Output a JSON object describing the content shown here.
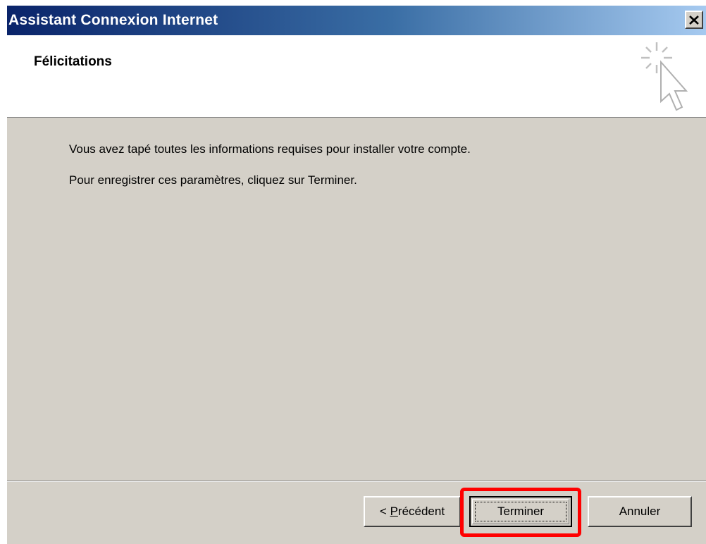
{
  "window": {
    "title": "Assistant Connexion Internet",
    "close_symbol": "✕",
    "close_icon": "close-icon"
  },
  "header": {
    "title": "Félicitations",
    "icon": "wizard-cursor-sparkle-icon"
  },
  "content": {
    "line1": "Vous avez tapé toutes les informations requises pour installer votre compte.",
    "line2": "Pour enregistrer ces paramètres, cliquez sur Terminer."
  },
  "buttons": {
    "prev_prefix": "< ",
    "prev_accel": "P",
    "prev_rest": "récédent",
    "finish": "Terminer",
    "cancel": "Annuler"
  },
  "colors": {
    "titlebar_start": "#0a246a",
    "titlebar_end": "#a6caf0",
    "dialog_bg": "#d4d0c8",
    "highlight": "#ff0000"
  }
}
